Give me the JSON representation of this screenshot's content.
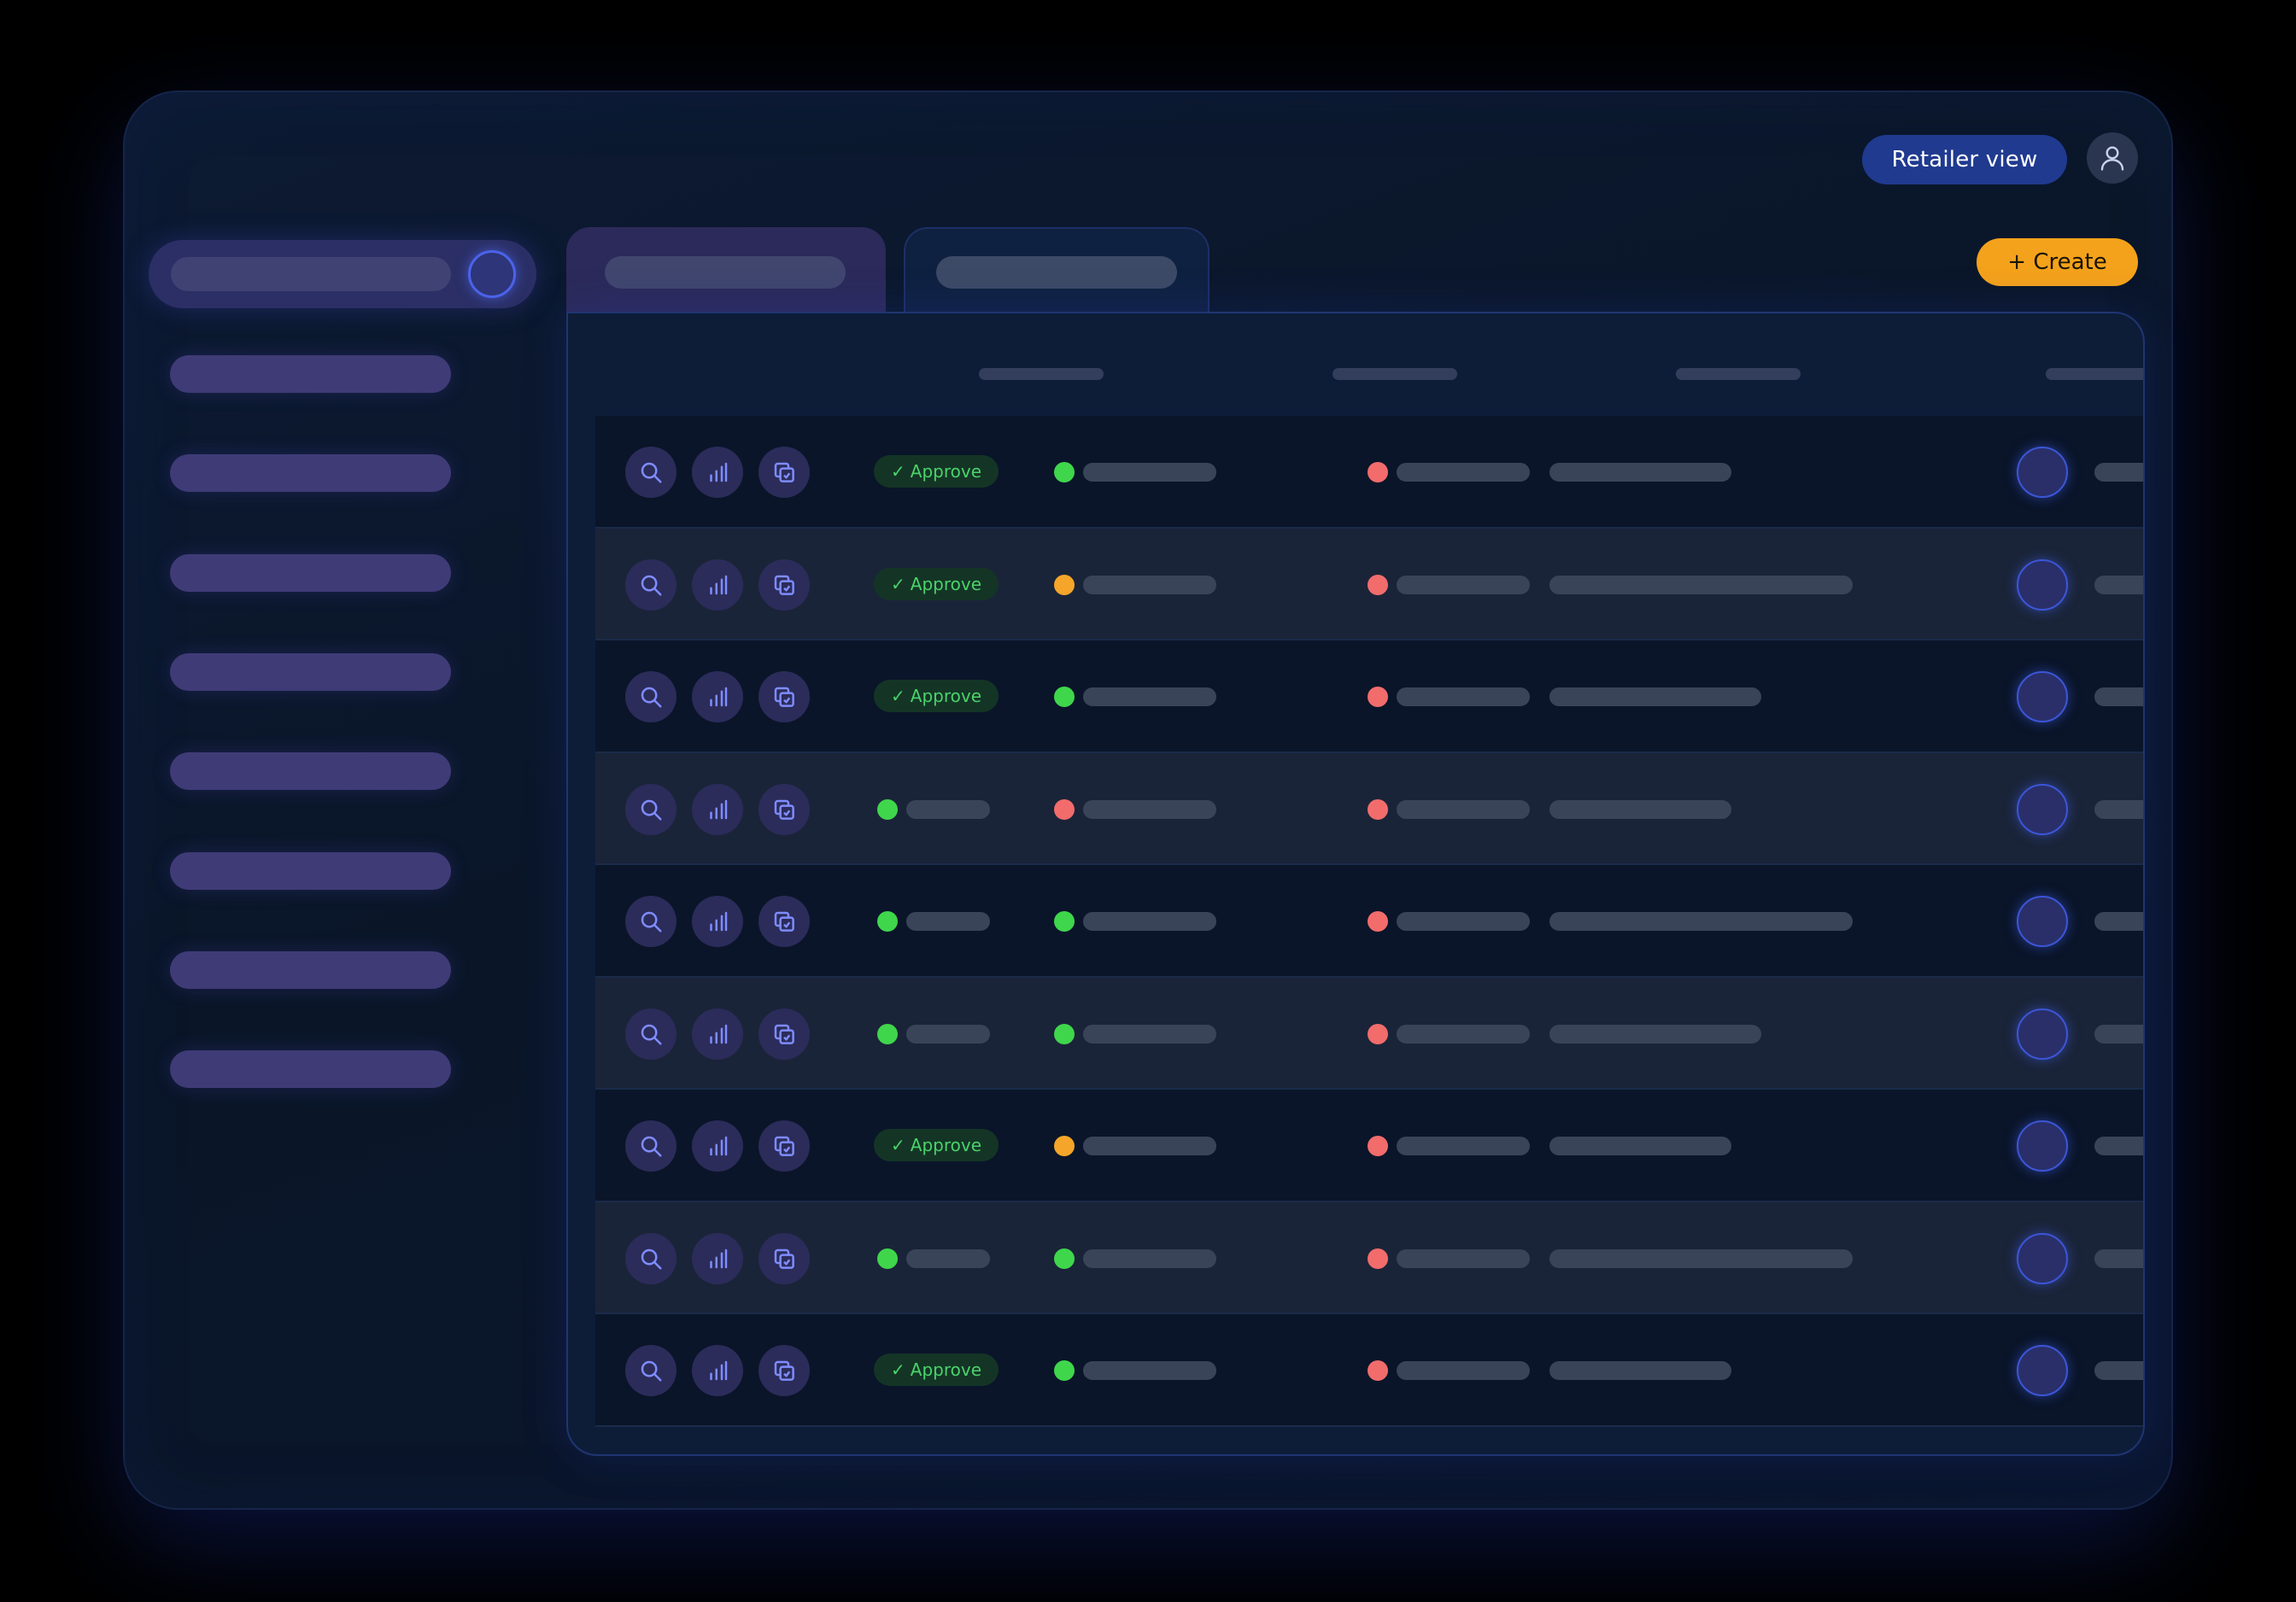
{
  "header": {
    "retailer_view_label": "Retailer view",
    "create_label": "+ Create",
    "icons": {
      "user": "user-icon"
    }
  },
  "sidebar": {
    "item_count": 8
  },
  "table": {
    "icons": [
      "search-icon",
      "bar-chart-icon",
      "copy-icon"
    ],
    "approve_label": "Approve",
    "rows": [
      {
        "status": "approve",
        "dot1": "green",
        "dot2": "red",
        "desc": "two"
      },
      {
        "status": "approve",
        "dot1": "orange",
        "dot2": "red",
        "desc": "long"
      },
      {
        "status": "approve",
        "dot1": "green",
        "dot2": "red",
        "desc": "medium"
      },
      {
        "status": "green",
        "dot1": "red",
        "dot2": "red",
        "desc": "two"
      },
      {
        "status": "green",
        "dot1": "green",
        "dot2": "red",
        "desc": "long"
      },
      {
        "status": "green",
        "dot1": "green",
        "dot2": "red",
        "desc": "medium"
      },
      {
        "status": "approve",
        "dot1": "orange",
        "dot2": "red",
        "desc": "two"
      },
      {
        "status": "green",
        "dot1": "green",
        "dot2": "red",
        "desc": "long"
      },
      {
        "status": "approve",
        "dot1": "green",
        "dot2": "red",
        "desc": "two"
      }
    ]
  },
  "colors": {
    "accent": "#1f3a8f",
    "create": "#f4a21b",
    "status_green": "#3fd64c",
    "status_orange": "#f5a52a",
    "status_red": "#f26c6c"
  }
}
